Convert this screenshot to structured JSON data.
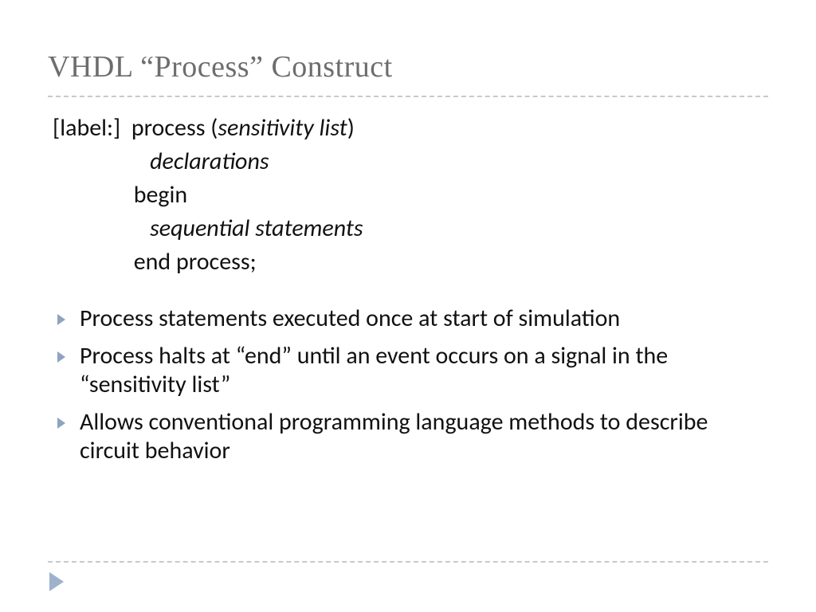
{
  "title": "VHDL “Process” Construct",
  "syntax": {
    "l1a": "[label:]  process (",
    "l1b": "sensitivity list",
    "l1c": ")",
    "l2": "declarations",
    "l3": "begin",
    "l4": "sequential statements",
    "l5": "end process;"
  },
  "bullets": [
    "Process statements executed once at start of simulation",
    "Process halts at “end” until an event occurs on a signal in the “sensitivity list”",
    "Allows conventional programming language methods to describe circuit behavior"
  ]
}
